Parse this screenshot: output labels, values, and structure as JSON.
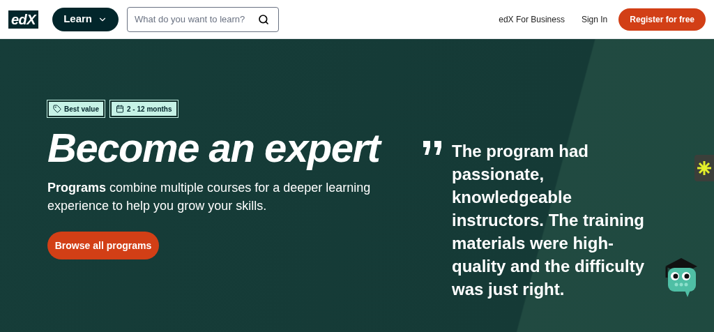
{
  "header": {
    "logo": "edX",
    "learn_button": "Learn",
    "search": {
      "placeholder": "What do you want to learn?"
    },
    "links": [
      "edX For Business",
      "Sign In"
    ],
    "register_button": "Register for free"
  },
  "hero": {
    "badges": [
      {
        "kind": "tag",
        "label": "Best value"
      },
      {
        "kind": "calendar",
        "label": "2 - 12 months"
      }
    ],
    "title": "Become an expert",
    "description": "**Programs** combine multiple courses for a deeper learning experience to help you grow your skills.",
    "button": "Browse all programs",
    "quote": "The program had passionate, knowledgeable instructors. The training materials were high-quality and the difficulty was just right."
  }
}
